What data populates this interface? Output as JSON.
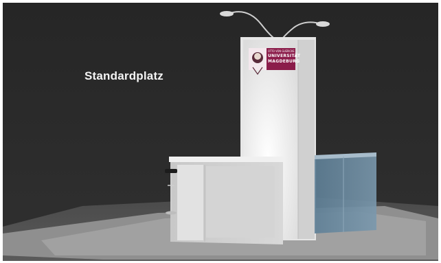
{
  "scene": {
    "heading": "Standardplatz"
  },
  "logo": {
    "line_small": "OTTO VON GUERICKE",
    "line_1": "UNIVERSITÄT",
    "line_2": "MAGDEBURG",
    "brand_color": "#8b1c4a"
  },
  "colors": {
    "wall": "#2a2a2a",
    "floor_dark": "#3c3c3c",
    "floor_light": "#9a9a9a",
    "panel": "#f2f2f2",
    "counter": "#cfcfcf",
    "glass": "#6f8fa5"
  }
}
